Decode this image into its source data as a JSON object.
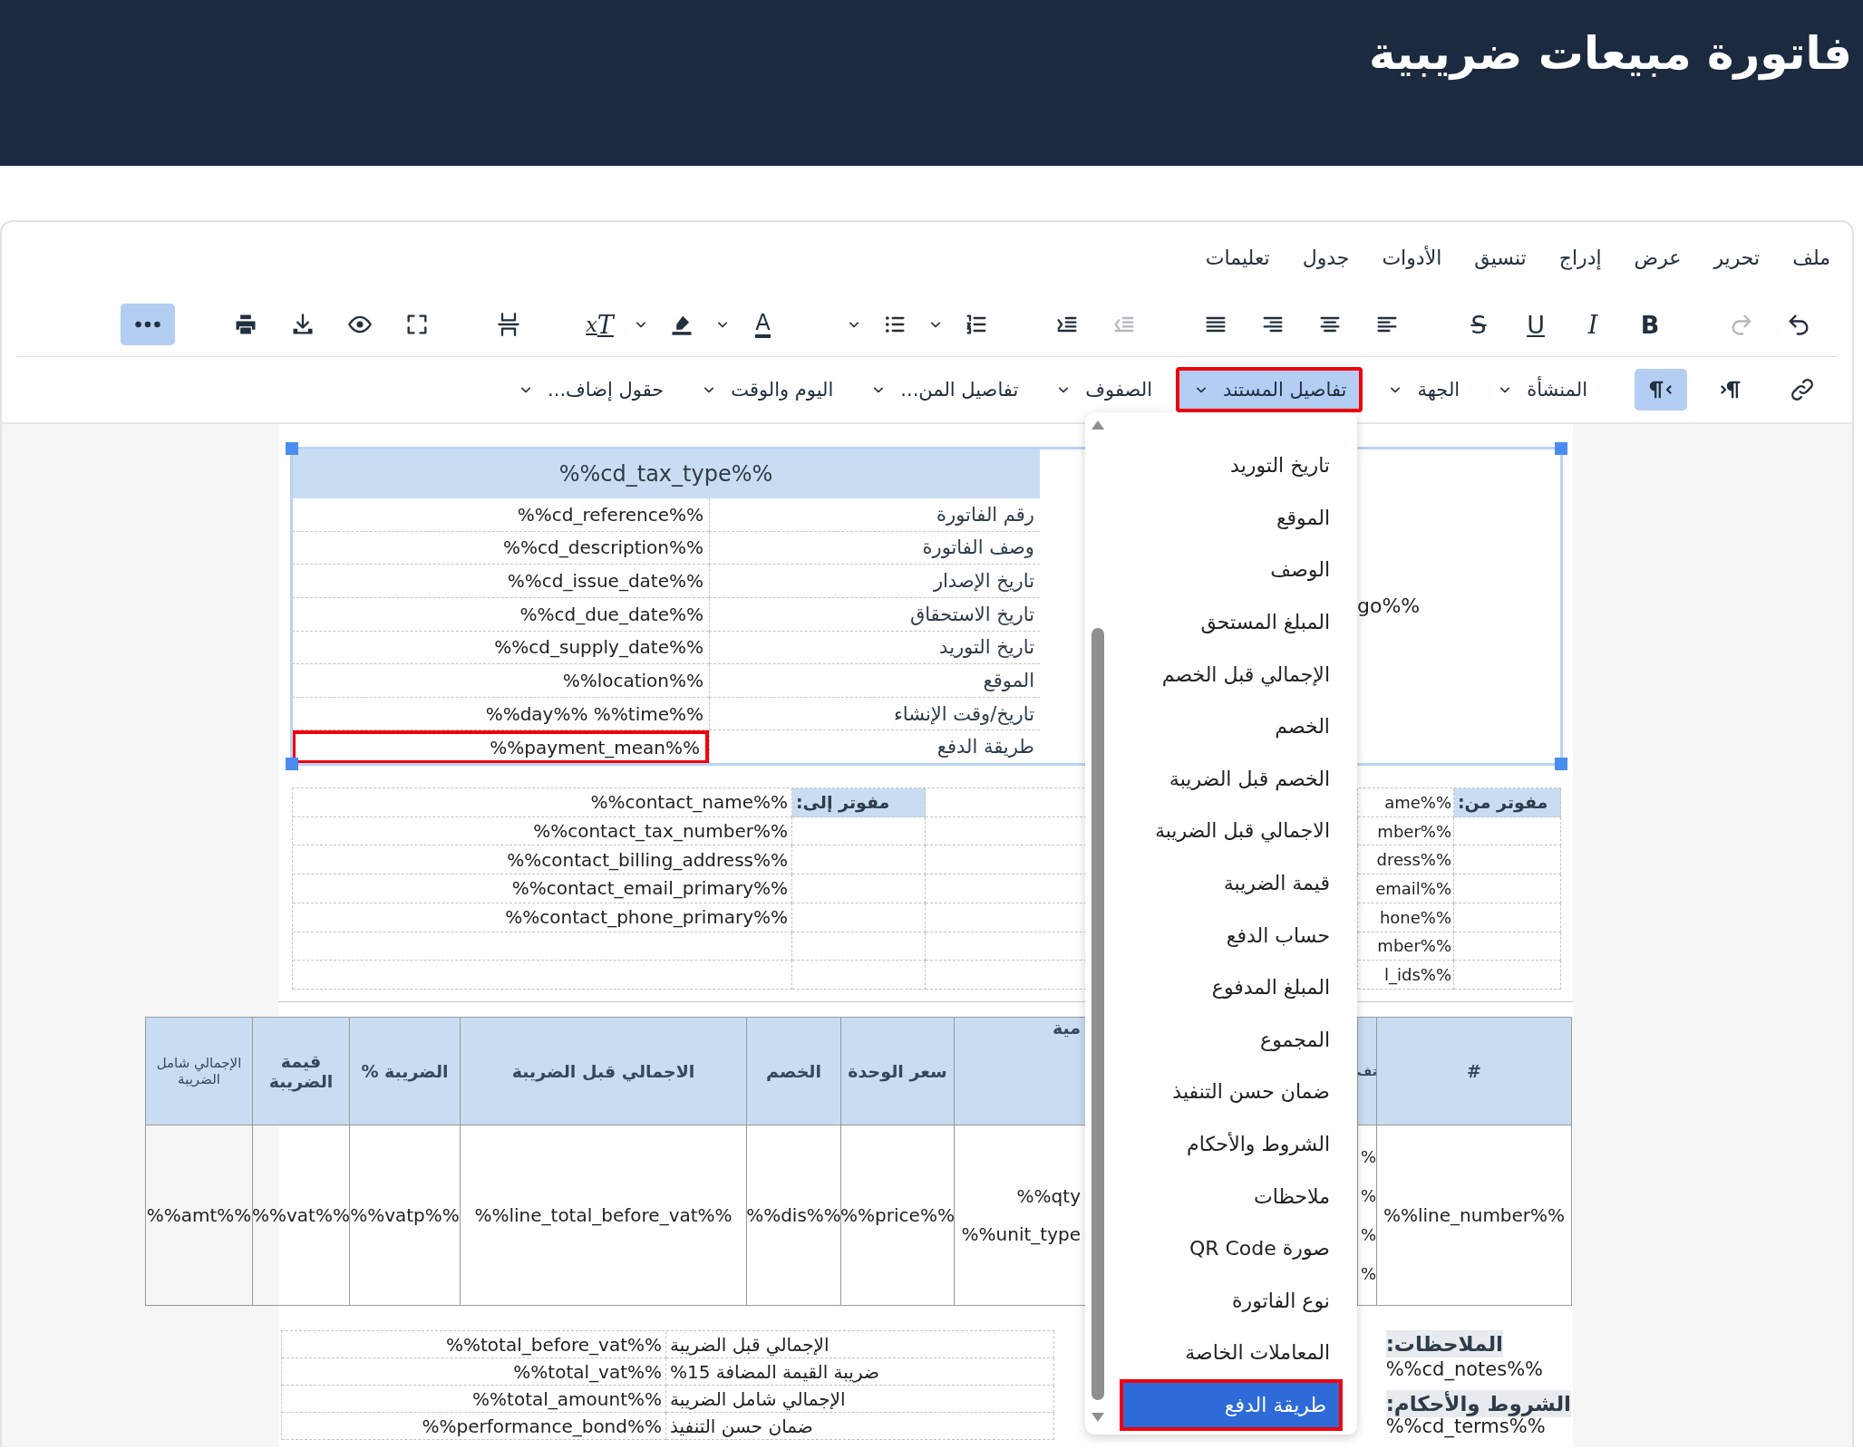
{
  "header": {
    "title": "فاتورة مبيعات ضريبية"
  },
  "menubar": [
    "ملف",
    "تحرير",
    "عرض",
    "إدراج",
    "تنسيق",
    "الأدوات",
    "جدول",
    "تعليمات"
  ],
  "toolbar": [
    [
      {
        "kind": "undo",
        "disabled": false,
        "active": false
      },
      {
        "kind": "redo",
        "disabled": true,
        "active": false
      }
    ],
    [
      {
        "kind": "bold",
        "label": "B",
        "disabled": false,
        "active": false
      },
      {
        "kind": "italic",
        "label": "I",
        "disabled": false,
        "active": false
      },
      {
        "kind": "underline",
        "label": "U",
        "disabled": false,
        "active": false
      },
      {
        "kind": "strike",
        "label": "S",
        "disabled": false,
        "active": false
      }
    ],
    [
      {
        "kind": "align_left",
        "disabled": false,
        "active": false
      },
      {
        "kind": "align_center",
        "disabled": false,
        "active": false
      },
      {
        "kind": "align_right",
        "disabled": false,
        "active": false
      },
      {
        "kind": "justify",
        "disabled": false,
        "active": false
      }
    ],
    [
      {
        "kind": "outdent",
        "disabled": true,
        "active": false
      },
      {
        "kind": "indent",
        "disabled": false,
        "active": false
      }
    ],
    [
      {
        "kind": "numlist",
        "disabled": false,
        "active": false
      },
      {
        "kind": "caret",
        "disabled": false,
        "active": false
      },
      {
        "kind": "bullist",
        "disabled": false,
        "active": false
      },
      {
        "kind": "caret",
        "disabled": false,
        "active": false
      }
    ],
    [
      {
        "kind": "fontcolor",
        "label": "A",
        "disabled": false,
        "active": false
      },
      {
        "kind": "caret",
        "disabled": false,
        "active": false
      },
      {
        "kind": "highlight",
        "disabled": false,
        "active": false
      },
      {
        "kind": "caret",
        "disabled": false,
        "active": false
      },
      {
        "kind": "clearformat",
        "label": "T$_{x}$",
        "disabled": false,
        "active": false
      }
    ],
    [
      {
        "kind": "pagebreak",
        "disabled": false,
        "active": false
      }
    ],
    [
      {
        "kind": "fullscreen",
        "disabled": false,
        "active": false
      },
      {
        "kind": "preview",
        "disabled": false,
        "active": false
      },
      {
        "kind": "download",
        "disabled": false,
        "active": false
      },
      {
        "kind": "print",
        "disabled": false,
        "active": false
      }
    ],
    [
      {
        "kind": "more",
        "disabled": false,
        "active": true
      }
    ]
  ],
  "format_bar": {
    "buttons": [
      {
        "kind": "link",
        "active": false
      },
      {
        "kind": "ltr",
        "active": false
      },
      {
        "kind": "rtl",
        "active": true
      }
    ],
    "menus": [
      {
        "label": "المنشأة",
        "open": false,
        "outlined": false
      },
      {
        "label": "الجهة",
        "open": false,
        "outlined": false
      },
      {
        "label": "تفاصيل المستند",
        "open": true,
        "outlined": true
      },
      {
        "label": "الصفوف",
        "open": false,
        "outlined": false
      },
      {
        "label": "تفاصيل المن...",
        "open": false,
        "outlined": false
      },
      {
        "label": "اليوم والوقت",
        "open": false,
        "outlined": false
      },
      {
        "label": "حقول إضاف...",
        "open": false,
        "outlined": false
      }
    ]
  },
  "document": {
    "details": {
      "title": "%%cd_tax_type%%",
      "logo": "go%%",
      "rows": [
        {
          "label": "رقم الفاتورة",
          "value": "%%cd_reference%%",
          "outlined": false
        },
        {
          "label": "وصف الفاتورة",
          "value": "%%cd_description%%",
          "outlined": false
        },
        {
          "label": "تاريخ الإصدار",
          "value": "%%cd_issue_date%%",
          "outlined": false
        },
        {
          "label": "تاريخ الاستحقاق",
          "value": "%%cd_due_date%%",
          "outlined": false
        },
        {
          "label": "تاريخ التوريد",
          "value": "%%cd_supply_date%%",
          "outlined": false
        },
        {
          "label": "الموقع",
          "value": "%%location%%",
          "outlined": false
        },
        {
          "label": "تاريخ/وقت الإنشاء",
          "value": "%%day%% %%time%%",
          "outlined": false
        },
        {
          "label": "طريقة الدفع",
          "value": "%%payment_mean%%",
          "outlined": true
        }
      ]
    },
    "billed_to": {
      "label": "مفوتر إلى:",
      "values": [
        "%%contact_name%%",
        "%%contact_tax_number%%",
        "%%contact_billing_address%%",
        "%%contact_email_primary%%",
        "%%contact_phone_primary%%"
      ]
    },
    "billed_from": {
      "label": "مفوتر من:",
      "values": [
        "ame%%",
        "mber%%",
        "dress%%",
        "email%%",
        "hone%%",
        "mber%%",
        "l_ids%%"
      ]
    },
    "items": {
      "columns": [
        {
          "label": "#",
          "cells": [
            "%%line_number%%"
          ]
        },
        {
          "label": "تف",
          "cells": [
            "%",
            "%",
            "%",
            "%"
          ]
        },
        {
          "label": "مية",
          "cells": [
            "%%qty",
            "%%unit_type"
          ]
        },
        {
          "label": "سعر الوحدة",
          "cells": [
            "%%price%%"
          ]
        },
        {
          "label": "الخصم",
          "cells": [
            "%%dis%%"
          ]
        },
        {
          "label": "الاجمالي قبل الضريبة",
          "cells": [
            "%%line_total_before_vat%%"
          ]
        },
        {
          "label": "الضريبة %",
          "cells": [
            "%%vatp%%"
          ]
        },
        {
          "label": "قيمة الضريبة",
          "cells": [
            "%%vat%%"
          ]
        },
        {
          "label": "الإجمالي شامل الضريبة",
          "cells": [
            "%%amt%%"
          ]
        }
      ]
    },
    "totals": [
      {
        "label": "الإجمالي قبل الضريبة",
        "value": "%%total_before_vat%%"
      },
      {
        "label": "ضريبة القيمة المضافة 15%",
        "value": "%%total_vat%%"
      },
      {
        "label": "الإجمالي شامل الضريبة",
        "value": "%%total_amount%%"
      },
      {
        "label": "ضمان حسن التنفيذ",
        "value": "%%performance_bond%%"
      }
    ],
    "notes": [
      {
        "label": "الملاحظات:",
        "value": "%%cd_notes%%"
      },
      {
        "label": "الشروط والأحكام:",
        "value": "%%cd_terms%%"
      }
    ]
  },
  "dropdown": {
    "items": [
      {
        "label": "تاريخ التوريد",
        "selected": false,
        "outlined": false
      },
      {
        "label": "الموقع",
        "selected": false,
        "outlined": false
      },
      {
        "label": "الوصف",
        "selected": false,
        "outlined": false
      },
      {
        "label": "المبلغ المستحق",
        "selected": false,
        "outlined": false
      },
      {
        "label": "الإجمالي قبل الخصم",
        "selected": false,
        "outlined": false
      },
      {
        "label": "الخصم",
        "selected": false,
        "outlined": false
      },
      {
        "label": "الخصم قبل الضريبة",
        "selected": false,
        "outlined": false
      },
      {
        "label": "الاجمالي قبل الضريبة",
        "selected": false,
        "outlined": false
      },
      {
        "label": "قيمة الضريبة",
        "selected": false,
        "outlined": false
      },
      {
        "label": "حساب الدفع",
        "selected": false,
        "outlined": false
      },
      {
        "label": "المبلغ المدفوع",
        "selected": false,
        "outlined": false
      },
      {
        "label": "المجموع",
        "selected": false,
        "outlined": false
      },
      {
        "label": "ضمان حسن التنفيذ",
        "selected": false,
        "outlined": false
      },
      {
        "label": "الشروط والأحكام",
        "selected": false,
        "outlined": false
      },
      {
        "label": "ملاحظات",
        "selected": false,
        "outlined": false
      },
      {
        "label": "صورة QR Code",
        "selected": false,
        "outlined": false
      },
      {
        "label": "نوع الفاتورة",
        "selected": false,
        "outlined": false
      },
      {
        "label": "المعاملات الخاصة",
        "selected": false,
        "outlined": false
      },
      {
        "label": "طريقة الدفع",
        "selected": true,
        "outlined": true
      }
    ]
  }
}
